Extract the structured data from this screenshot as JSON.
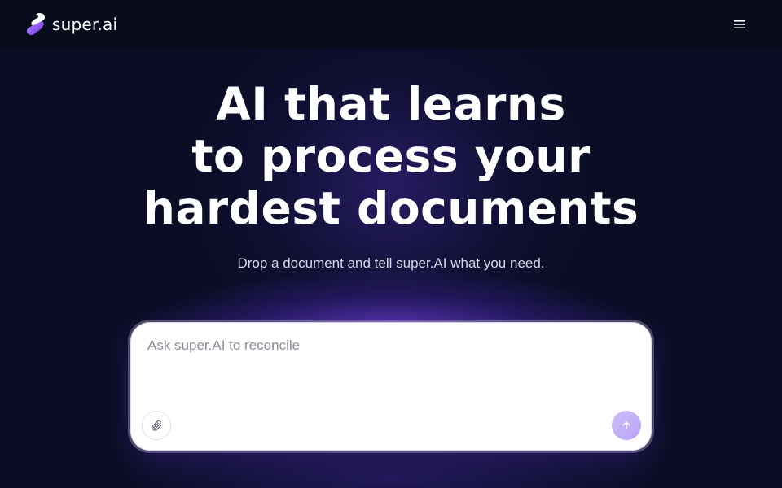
{
  "header": {
    "brand_name": "super.ai",
    "logo_icon": "super-ai-logo",
    "menu_icon": "hamburger-menu-icon"
  },
  "hero": {
    "headline_lines": [
      "AI that learns",
      "to process your",
      "hardest documents"
    ],
    "subtitle": "Drop a document and tell super.AI what you need."
  },
  "prompt": {
    "placeholder": "Ask super.AI to reconcile",
    "value": "",
    "attach_icon": "paperclip-icon",
    "send_icon": "arrow-up-icon"
  },
  "colors": {
    "background": "#0a0d24",
    "topbar": "#070b1c",
    "accent": "#7b4ff0",
    "send_button": "#c4b0f8",
    "text_primary": "#ffffff",
    "text_secondary": "#d7d8e8"
  }
}
